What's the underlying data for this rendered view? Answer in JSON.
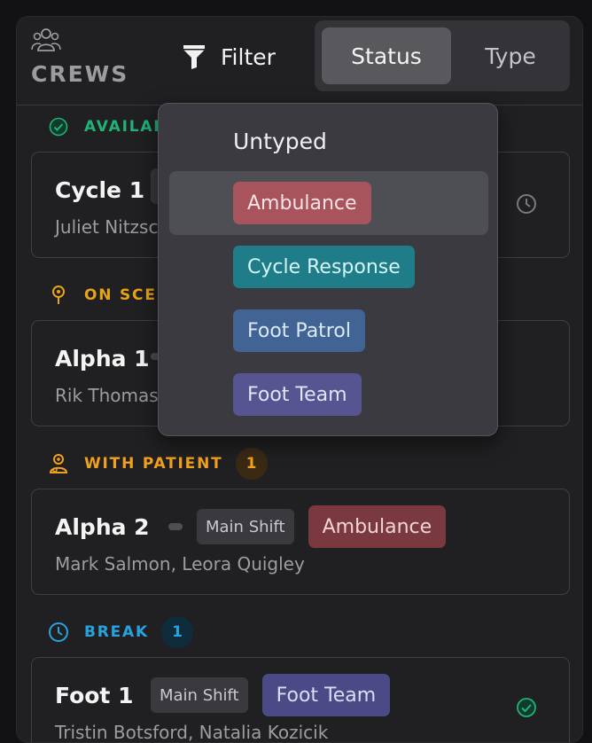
{
  "header": {
    "title": "CREWS",
    "filter_label": "Filter",
    "segments": [
      "Status",
      "Type"
    ],
    "active_segment": "Status"
  },
  "sections": [
    {
      "label": "AVAILABLE",
      "count": "",
      "color": "#1fb37a"
    },
    {
      "label": "ON SCENE",
      "count": "",
      "color": "#e8a317"
    },
    {
      "label": "WITH PATIENT",
      "count": "1",
      "color": "#f0a11e"
    },
    {
      "label": "BREAK",
      "count": "1",
      "color": "#27a3e0"
    }
  ],
  "cards": [
    {
      "name": "Cycle 1",
      "crew": "Juliet Nitzsche",
      "status_icon": "clock-icon"
    },
    {
      "name": "Alpha 1",
      "crew": "Rik Thomas"
    },
    {
      "name": "Alpha 2",
      "shift": "Main Shift",
      "type": "Ambulance",
      "crew": "Mark Salmon, Leora Quigley"
    },
    {
      "name": "Foot 1",
      "shift": "Main Shift",
      "type": "Foot Team",
      "crew": "Tristin Botsford, Natalia Kozicik",
      "status_icon": "check-circle-icon"
    }
  ],
  "dropdown": {
    "untyped_label": "Untyped",
    "options": [
      {
        "label": "Ambulance",
        "color": "#a8545d"
      },
      {
        "label": "Cycle Response",
        "color": "#1f7d89"
      },
      {
        "label": "Foot Patrol",
        "color": "#426494"
      },
      {
        "label": "Foot Team",
        "color": "#565592"
      }
    ],
    "hovered": "Ambulance"
  }
}
